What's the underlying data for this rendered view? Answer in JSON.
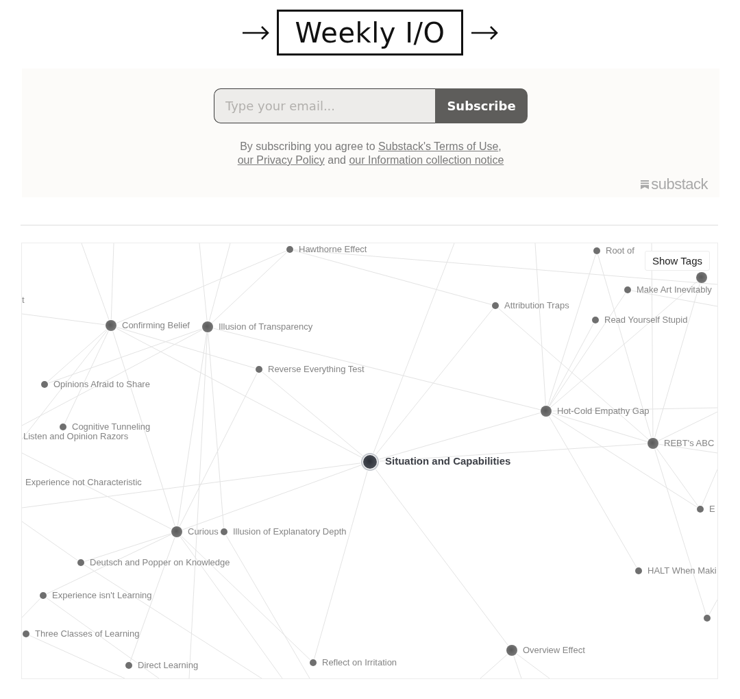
{
  "header": {
    "logo": {
      "title": "Weekly I/O"
    }
  },
  "subscribe": {
    "email_field": {
      "placeholder": "Type your email..."
    },
    "button": "Subscribe",
    "notice": [
      {
        "kind": "text",
        "text": "By subscribing you agree to "
      },
      {
        "kind": "link",
        "text": "Substack's Terms of Use"
      },
      {
        "kind": "text",
        "text": ", "
      },
      {
        "kind": "link",
        "text": "our Privacy Policy"
      },
      {
        "kind": "text",
        "text": " and "
      },
      {
        "kind": "link",
        "text": "our Information collection notice"
      }
    ],
    "brand": "substack"
  },
  "graph": {
    "show_tags_button": "Show Tags",
    "nodes": [
      {
        "kind": "minor",
        "label": "Hawthorne Effect"
      },
      {
        "kind": "minor",
        "label": "Root of"
      },
      {
        "kind": "major"
      },
      {
        "kind": "minor",
        "label": "Make Art Inevitably"
      },
      {
        "kind": "offscreen",
        "label": "t"
      },
      {
        "kind": "minor",
        "label": "Attribution Traps"
      },
      {
        "kind": "minor",
        "label": "Read Yourself Stupid"
      },
      {
        "kind": "major",
        "label": "Confirming Belief"
      },
      {
        "kind": "major",
        "label": "Illusion of Transparency"
      },
      {
        "kind": "minor",
        "label": "Reverse Everything Test"
      },
      {
        "kind": "minor",
        "label": "Opinions Afraid to Share"
      },
      {
        "kind": "major",
        "label": "Hot-Cold Empathy Gap"
      },
      {
        "kind": "minor",
        "label": "Cognitive Tunneling"
      },
      {
        "kind": "offscreen",
        "label": "Listen and Opinion Razors"
      },
      {
        "kind": "major",
        "label": "REBT's ABC"
      },
      {
        "kind": "focus",
        "label": "Situation and Capabilities"
      },
      {
        "kind": "offscreen",
        "label": "Experience not Characteristic"
      },
      {
        "kind": "minor",
        "label": "E"
      },
      {
        "kind": "major",
        "label": "Curious"
      },
      {
        "kind": "minor",
        "label": "Illusion of Explanatory Depth"
      },
      {
        "kind": "minor",
        "label": "Deutsch and Popper on Knowledge"
      },
      {
        "kind": "minor",
        "label": "HALT When Maki"
      },
      {
        "kind": "minor",
        "label": "Experience isn't Learning"
      },
      {
        "kind": "minor"
      },
      {
        "kind": "minor",
        "label": "Three Classes of Learning"
      },
      {
        "kind": "major",
        "label": "Overview Effect"
      },
      {
        "kind": "minor",
        "label": "Reflect on Irritation"
      },
      {
        "kind": "minor",
        "label": "Direct Learning"
      }
    ]
  }
}
